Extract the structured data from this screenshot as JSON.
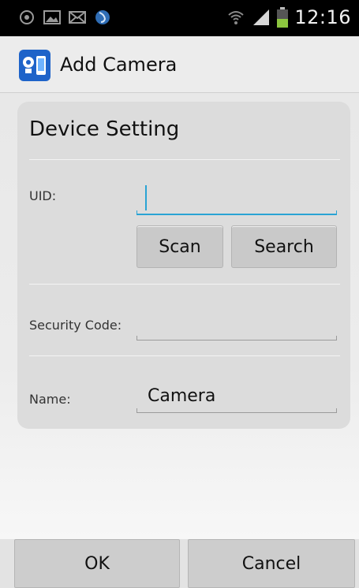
{
  "status_bar": {
    "time": "12:16",
    "icons": [
      "notification-icon",
      "gallery-icon",
      "mail-icon",
      "sync-icon",
      "wifi-icon",
      "signal-icon",
      "battery-icon"
    ]
  },
  "action_bar": {
    "title": "Add Camera",
    "app_icon": "camera-app-icon"
  },
  "device_setting": {
    "title": "Device Setting",
    "uid": {
      "label": "UID:",
      "value": "",
      "placeholder": ""
    },
    "scan_label": "Scan",
    "search_label": "Search",
    "security_code": {
      "label": "Security Code:",
      "value": "",
      "placeholder": ""
    },
    "name": {
      "label": "Name:",
      "value": "Camera",
      "placeholder": ""
    }
  },
  "bottom_buttons": {
    "ok_label": "OK",
    "cancel_label": "Cancel"
  },
  "colors": {
    "accent": "#2aa3d4",
    "status_bar_bg": "#000000",
    "battery_green": "#8cc63f"
  }
}
